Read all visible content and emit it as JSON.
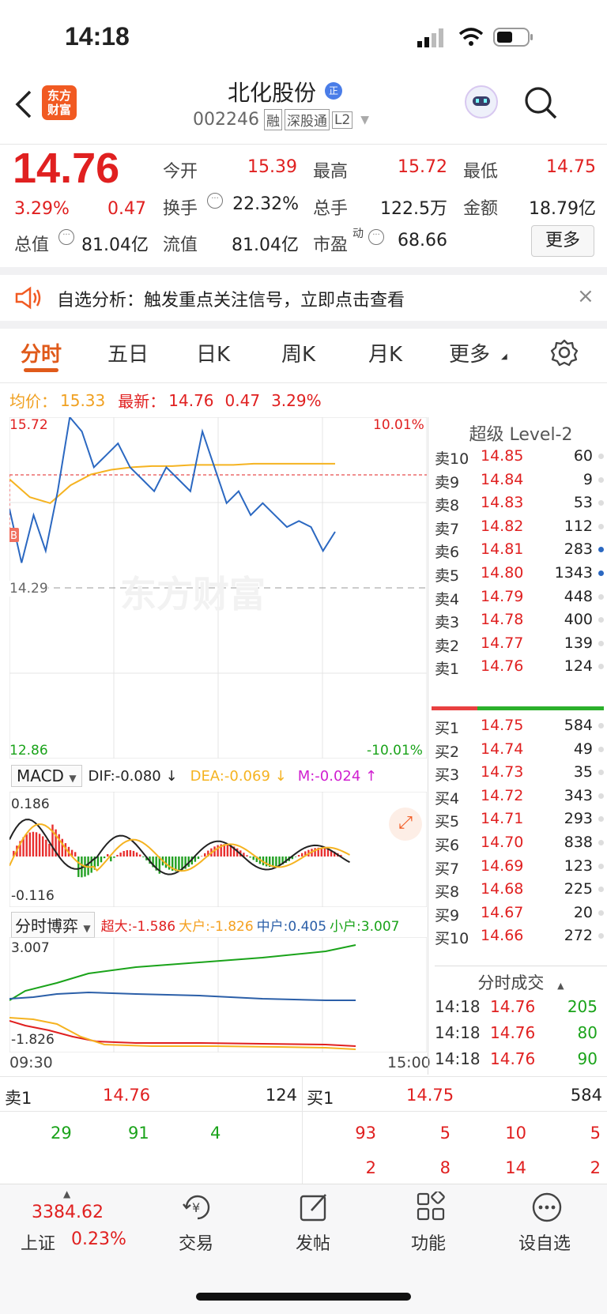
{
  "status": {
    "time": "14:18"
  },
  "header": {
    "title": "北化股份",
    "title_badge": "正",
    "code": "002246",
    "tags": [
      "融",
      "深股通",
      "L2"
    ],
    "logo_text": [
      "东方",
      "财富"
    ]
  },
  "quote": {
    "price": "14.76",
    "pct": "3.29%",
    "chg": "0.47",
    "rows": [
      [
        {
          "l": "今开",
          "v": "15.39",
          "c": "red"
        },
        {
          "l": "最高",
          "v": "15.72",
          "c": "red"
        },
        {
          "l": "最低",
          "v": "14.75",
          "c": "red"
        }
      ],
      [
        {
          "l": "换手",
          "v": "22.32%",
          "c": "dark"
        },
        {
          "l": "总手",
          "v": "122.5万",
          "c": "dark"
        },
        {
          "l": "金额",
          "v": "18.79亿",
          "c": "dark"
        }
      ],
      [
        {
          "l": "总值",
          "v": "81.04亿",
          "c": "dark"
        },
        {
          "l": "流值",
          "v": "81.04亿",
          "c": "dark"
        },
        {
          "l": "市盈",
          "v": "68.66",
          "c": "dark"
        }
      ]
    ],
    "pe_sup": "动",
    "more": "更多"
  },
  "notice": {
    "text": "自选分析：触发重点关注信号，立即点击查看"
  },
  "tabs": [
    "分时",
    "五日",
    "日K",
    "周K",
    "月K",
    "更多"
  ],
  "info_line": {
    "avg_label": "均价：",
    "avg": "15.33",
    "latest_label": "最新：",
    "latest": "14.76",
    "chg": "0.47",
    "pct": "3.29%"
  },
  "chart_labels": {
    "top": "15.72",
    "top_pct": "10.01%",
    "mid": "14.29",
    "bottom": "12.86",
    "bottom_pct": "-10.01%",
    "watermark": "东方财富",
    "marker": "B"
  },
  "macd": {
    "selector": "MACD",
    "dif": "DIF:-0.080 ↓",
    "dea": "DEA:-0.069 ↓",
    "m": "M:-0.024 ↑",
    "top": "0.186",
    "bottom": "-0.116"
  },
  "game": {
    "selector": "分时博弈",
    "super": "超大:-1.586",
    "large": "大户:-1.826",
    "mid": "中户:0.405",
    "small": "小户:3.007",
    "top": "3.007",
    "bottom": "-1.826",
    "t_start": "09:30",
    "t_end": "15:00"
  },
  "level2": {
    "title": "超级 Level-2",
    "asks": [
      [
        "卖10",
        "14.85",
        "60"
      ],
      [
        "卖9",
        "14.84",
        "9"
      ],
      [
        "卖8",
        "14.83",
        "53"
      ],
      [
        "卖7",
        "14.82",
        "112"
      ],
      [
        "卖6",
        "14.81",
        "283"
      ],
      [
        "卖5",
        "14.80",
        "1343"
      ],
      [
        "卖4",
        "14.79",
        "448"
      ],
      [
        "卖3",
        "14.78",
        "400"
      ],
      [
        "卖2",
        "14.77",
        "139"
      ],
      [
        "卖1",
        "14.76",
        "124"
      ]
    ],
    "bids": [
      [
        "买1",
        "14.75",
        "584"
      ],
      [
        "买2",
        "14.74",
        "49"
      ],
      [
        "买3",
        "14.73",
        "35"
      ],
      [
        "买4",
        "14.72",
        "343"
      ],
      [
        "买5",
        "14.71",
        "293"
      ],
      [
        "买6",
        "14.70",
        "838"
      ],
      [
        "买7",
        "14.69",
        "123"
      ],
      [
        "买8",
        "14.68",
        "225"
      ],
      [
        "买9",
        "14.67",
        "20"
      ],
      [
        "买10",
        "14.66",
        "272"
      ]
    ],
    "trades_title": "分时成交",
    "trades": [
      [
        "14:18",
        "14.76",
        "205"
      ],
      [
        "14:18",
        "14.76",
        "80"
      ],
      [
        "14:18",
        "14.76",
        "90"
      ]
    ]
  },
  "queue": {
    "sell_label": "卖1",
    "sell_price": "14.76",
    "sell_vol": "124",
    "sell_items": [
      "29",
      "91",
      "4"
    ],
    "buy_label": "买1",
    "buy_price": "14.75",
    "buy_vol": "584",
    "buy_items_1": [
      "93",
      "5",
      "10",
      "5"
    ],
    "buy_items_2": [
      "2",
      "8",
      "14",
      "2"
    ]
  },
  "bottom": {
    "index_value": "3384.62",
    "index_name": "上证",
    "index_pct": "0.23%",
    "items": [
      "交易",
      "发帖",
      "功能",
      "设自选"
    ]
  },
  "chart_data": {
    "type": "line",
    "title": "",
    "x_range": [
      "09:30",
      "15:00"
    ],
    "ylim": [
      12.86,
      15.72
    ],
    "series": [
      {
        "name": "",
        "values": [
          14.95,
          14.5,
          14.9,
          14.6,
          15.1,
          15.72,
          15.6,
          15.3,
          15.4,
          15.5,
          15.3,
          15.2,
          15.1,
          15.3,
          15.2,
          15.1,
          15.6,
          15.3,
          15.0,
          15.1,
          14.9,
          15.0,
          14.9,
          14.8,
          14.85,
          14.8,
          14.6,
          14.76
        ]
      },
      {
        "name": "",
        "values": [
          15.2,
          15.05,
          15.0,
          15.15,
          15.24,
          15.28,
          15.3,
          15.31,
          15.31,
          15.32,
          15.32,
          15.32,
          15.33,
          15.33,
          15.33,
          15.33,
          15.33
        ]
      }
    ]
  }
}
